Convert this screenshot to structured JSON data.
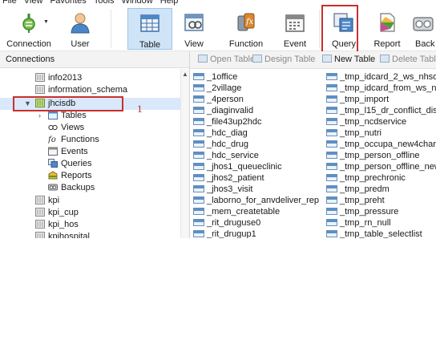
{
  "menubar": [
    "File",
    "View",
    "Favorites",
    "Tools",
    "Window",
    "Help"
  ],
  "toolbar": {
    "buttons": [
      {
        "label": "Connection",
        "icon": "connection-icon"
      },
      {
        "label": "User",
        "icon": "user-icon"
      },
      {
        "label": "Table",
        "icon": "table-icon",
        "active": true
      },
      {
        "label": "View",
        "icon": "view-icon"
      },
      {
        "label": "Function",
        "icon": "function-icon"
      },
      {
        "label": "Event",
        "icon": "event-icon"
      },
      {
        "label": "Query",
        "icon": "query-icon",
        "highlighted": true
      },
      {
        "label": "Report",
        "icon": "report-icon"
      },
      {
        "label": "Back",
        "icon": "backup-icon"
      }
    ]
  },
  "connections": {
    "header": "Connections",
    "tree": [
      {
        "label": "info2013",
        "icon": "database-icon",
        "level": 1
      },
      {
        "label": "information_schema",
        "icon": "database-icon",
        "level": 1
      },
      {
        "label": "jhcisdb",
        "icon": "database-open-icon",
        "level": 1,
        "expanded": true,
        "selected": true
      },
      {
        "label": "Tables",
        "icon": "tables-icon",
        "level": 2
      },
      {
        "label": "Views",
        "icon": "views-icon",
        "level": 2
      },
      {
        "label": "Functions",
        "icon": "functions-icon",
        "level": 2
      },
      {
        "label": "Events",
        "icon": "events-icon",
        "level": 2
      },
      {
        "label": "Queries",
        "icon": "queries-icon",
        "level": 2
      },
      {
        "label": "Reports",
        "icon": "reports-icon",
        "level": 2
      },
      {
        "label": "Backups",
        "icon": "backups-icon",
        "level": 2
      },
      {
        "label": "kpi",
        "icon": "database-icon",
        "level": 1
      },
      {
        "label": "kpi_cup",
        "icon": "database-icon",
        "level": 1
      },
      {
        "label": "kpi_hos",
        "icon": "database-icon",
        "level": 1
      },
      {
        "label": "kpihospital",
        "icon": "database-icon",
        "level": 1
      }
    ],
    "annotation": "1"
  },
  "objects": {
    "toolbar": [
      {
        "label": "Open Table",
        "enabled": false
      },
      {
        "label": "Design Table",
        "enabled": false
      },
      {
        "label": "New Table",
        "enabled": true
      },
      {
        "label": "Delete Tabl",
        "enabled": false
      }
    ],
    "col1": [
      "_1office",
      "_2village",
      "_4person",
      "_diaginvalid",
      "_file43up2hdc",
      "_hdc_diag",
      "_hdc_drug",
      "_hdc_service",
      "_jhos1_queueclinic",
      "_jhos2_patient",
      "_jhos3_visit",
      "_laborno_for_anvdeliver_rep",
      "_mem_createtable",
      "_rit_druguse0",
      "_rit_drugup1"
    ],
    "col2": [
      "_tmp_idcard_2_ws_nhso",
      "_tmp_idcard_from_ws_nhso",
      "_tmp_import",
      "_tmp_l15_dr_conflict_dise",
      "_tmp_ncdservice",
      "_tmp_nutri",
      "_tmp_occupa_new4char",
      "_tmp_person_offline",
      "_tmp_person_offline_new",
      "_tmp_prechronic",
      "_tmp_predm",
      "_tmp_preht",
      "_tmp_pressure",
      "_tmp_rn_null",
      "_tmp_table_selectlist"
    ]
  }
}
